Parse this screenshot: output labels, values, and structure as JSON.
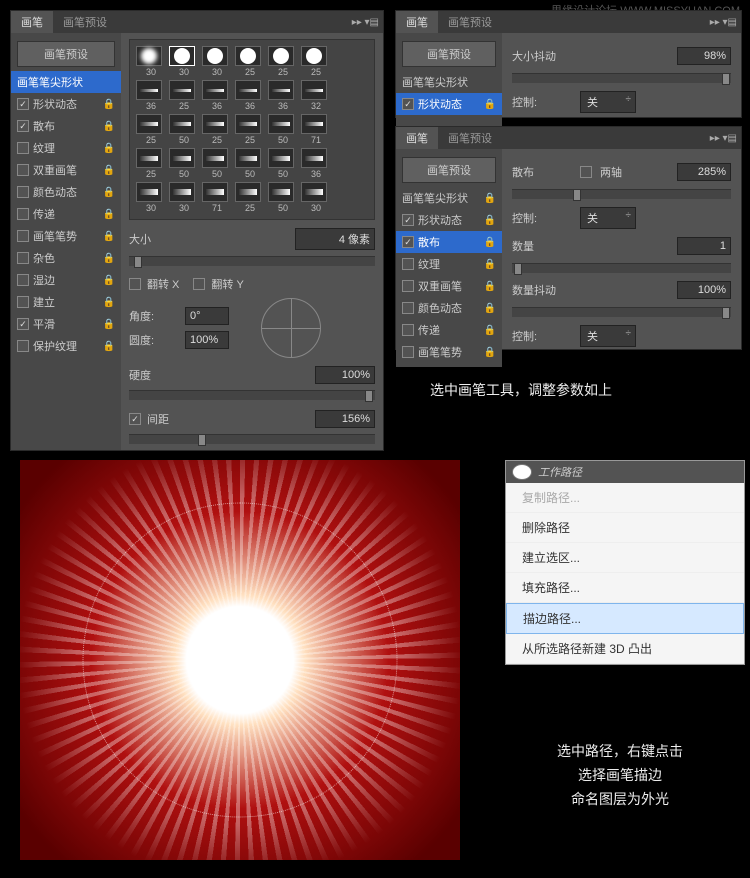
{
  "watermark": {
    "site": "思缘设计论坛",
    "url": "WWW.MISSYUAN.COM"
  },
  "tabs": {
    "brush": "画笔",
    "brush_preset": "画笔预设",
    "menu_arrows": "▸▸ ▾▤"
  },
  "sidebar": {
    "preset_btn": "画笔预设",
    "items": [
      {
        "label": "画笔笔尖形状",
        "checked": null,
        "selected": true,
        "lock": false
      },
      {
        "label": "形状动态",
        "checked": true,
        "lock": true
      },
      {
        "label": "散布",
        "checked": true,
        "lock": true
      },
      {
        "label": "纹理",
        "checked": false,
        "lock": true
      },
      {
        "label": "双重画笔",
        "checked": false,
        "lock": true
      },
      {
        "label": "颜色动态",
        "checked": false,
        "lock": true
      },
      {
        "label": "传递",
        "checked": false,
        "lock": true
      },
      {
        "label": "画笔笔势",
        "checked": false,
        "lock": true
      },
      {
        "label": "杂色",
        "checked": false,
        "lock": true
      },
      {
        "label": "湿边",
        "checked": false,
        "lock": true
      },
      {
        "label": "建立",
        "checked": false,
        "lock": true
      },
      {
        "label": "平滑",
        "checked": true,
        "lock": true
      },
      {
        "label": "保护纹理",
        "checked": false,
        "lock": true
      }
    ]
  },
  "brush_tips": [
    {
      "s": "30"
    },
    {
      "s": "30",
      "sel": true
    },
    {
      "s": "30"
    },
    {
      "s": "25"
    },
    {
      "s": "25"
    },
    {
      "s": "25"
    },
    {
      "s": "36"
    },
    {
      "s": "25"
    },
    {
      "s": "36"
    },
    {
      "s": "36"
    },
    {
      "s": "36"
    },
    {
      "s": "32"
    },
    {
      "s": "25"
    },
    {
      "s": "50"
    },
    {
      "s": "25"
    },
    {
      "s": "25"
    },
    {
      "s": "50"
    },
    {
      "s": "71"
    },
    {
      "s": "25"
    },
    {
      "s": "50"
    },
    {
      "s": "50"
    },
    {
      "s": "50"
    },
    {
      "s": "50"
    },
    {
      "s": "36"
    },
    {
      "s": "30"
    },
    {
      "s": "30"
    },
    {
      "s": "71"
    },
    {
      "s": "25"
    },
    {
      "s": "50"
    },
    {
      "s": "30"
    }
  ],
  "tip": {
    "size_lbl": "大小",
    "size_val": "4 像素",
    "flip_x": "翻转 X",
    "flip_y": "翻转 Y",
    "angle_lbl": "角度:",
    "angle_val": "0°",
    "round_lbl": "圆度:",
    "round_val": "100%",
    "hardness_lbl": "硬度",
    "hardness_val": "100%",
    "spacing_lbl": "间距",
    "spacing_val": "156%"
  },
  "panel2": {
    "size_jitter": "大小抖动",
    "size_jitter_val": "98%",
    "control": "控制:",
    "control_val": "关"
  },
  "panel3": {
    "scatter": "散布",
    "both_axes": "两轴",
    "scatter_val": "285%",
    "control": "控制:",
    "control_val": "关",
    "count": "数量",
    "count_val": "1",
    "count_jitter": "数量抖动",
    "count_jitter_val": "100%",
    "control2": "控制:",
    "control2_val": "关",
    "items": [
      {
        "label": "画笔笔尖形状",
        "checked": null
      },
      {
        "label": "形状动态",
        "checked": true
      },
      {
        "label": "散布",
        "checked": true,
        "selected": true
      },
      {
        "label": "纹理",
        "checked": false
      },
      {
        "label": "双重画笔",
        "checked": false
      },
      {
        "label": "颜色动态",
        "checked": false
      },
      {
        "label": "传递",
        "checked": false
      },
      {
        "label": "画笔笔势",
        "checked": false
      }
    ]
  },
  "caption1": "选中画笔工具，调整参数如上",
  "caption2": "选中路径，右键点击\n选择画笔描边\n命名图层为外光",
  "paths": {
    "title": "工作路径",
    "menu": [
      {
        "label": "复制路径...",
        "disabled": true
      },
      {
        "label": "删除路径"
      },
      {
        "label": "建立选区..."
      },
      {
        "label": "填充路径..."
      },
      {
        "label": "描边路径...",
        "hover": true
      },
      {
        "label": "从所选路径新建 3D 凸出"
      }
    ]
  }
}
